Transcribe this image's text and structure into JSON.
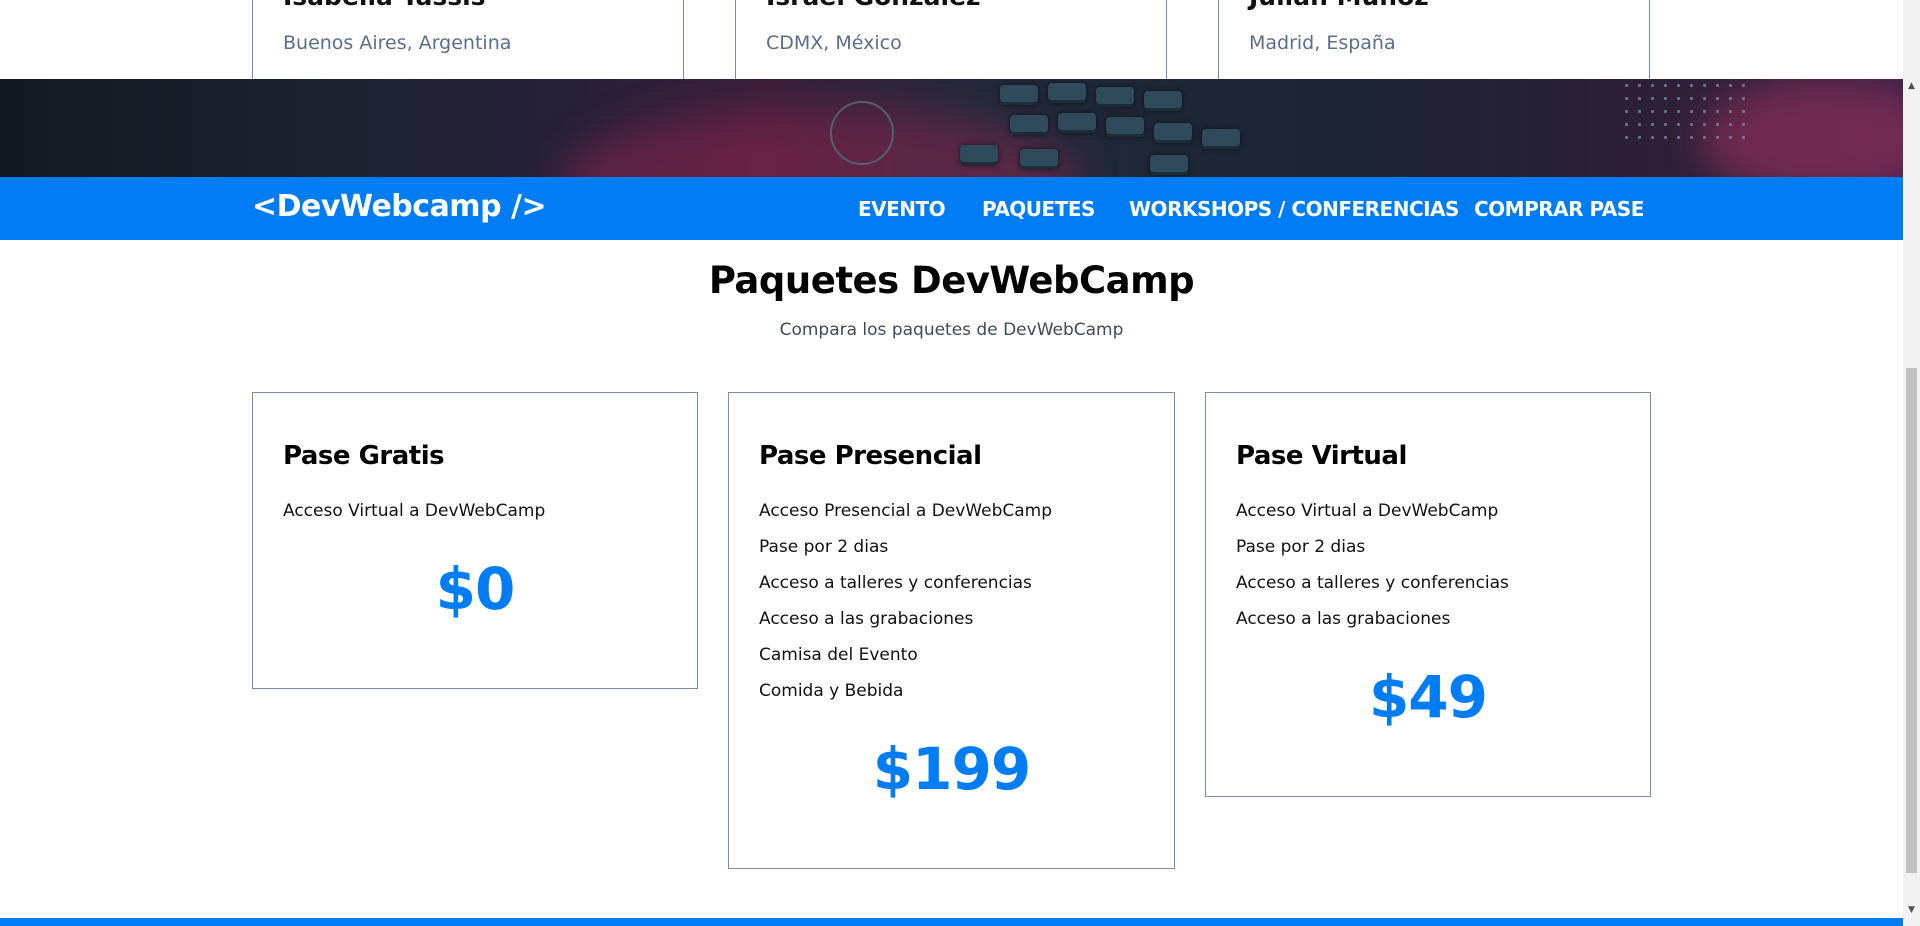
{
  "speakers": [
    {
      "name": "Isabella Tassis",
      "location": "Buenos Aires, Argentina"
    },
    {
      "name": "Israel González",
      "location": "CDMX, México"
    },
    {
      "name": "Julián Muñoz",
      "location": "Madrid, España"
    }
  ],
  "header": {
    "logo": "<DevWebcamp />",
    "nav": [
      "EVENTO",
      "PAQUETES",
      "WORKSHOPS / CONFERENCIAS",
      "COMPRAR PASE"
    ]
  },
  "section": {
    "title": "Paquetes DevWebCamp",
    "subtitle": "Compara los paquetes de DevWebCamp"
  },
  "packages": [
    {
      "title": "Pase Gratis",
      "features": [
        "Acceso Virtual a DevWebCamp"
      ],
      "price": "$0"
    },
    {
      "title": "Pase Presencial",
      "features": [
        "Acceso Presencial a DevWebCamp",
        "Pase por 2 dias",
        "Acceso a talleres y conferencias",
        "Acceso a las grabaciones",
        "Camisa del Evento",
        "Comida y Bebida"
      ],
      "price": "$199"
    },
    {
      "title": "Pase Virtual",
      "features": [
        "Acceso Virtual a DevWebCamp",
        "Pase por 2 dias",
        "Acceso a talleres y conferencias",
        "Acceso a las grabaciones"
      ],
      "price": "$49"
    }
  ],
  "colors": {
    "accent": "#007df4",
    "border": "#7b8bb0",
    "muted_text": "#5a6d8c"
  }
}
